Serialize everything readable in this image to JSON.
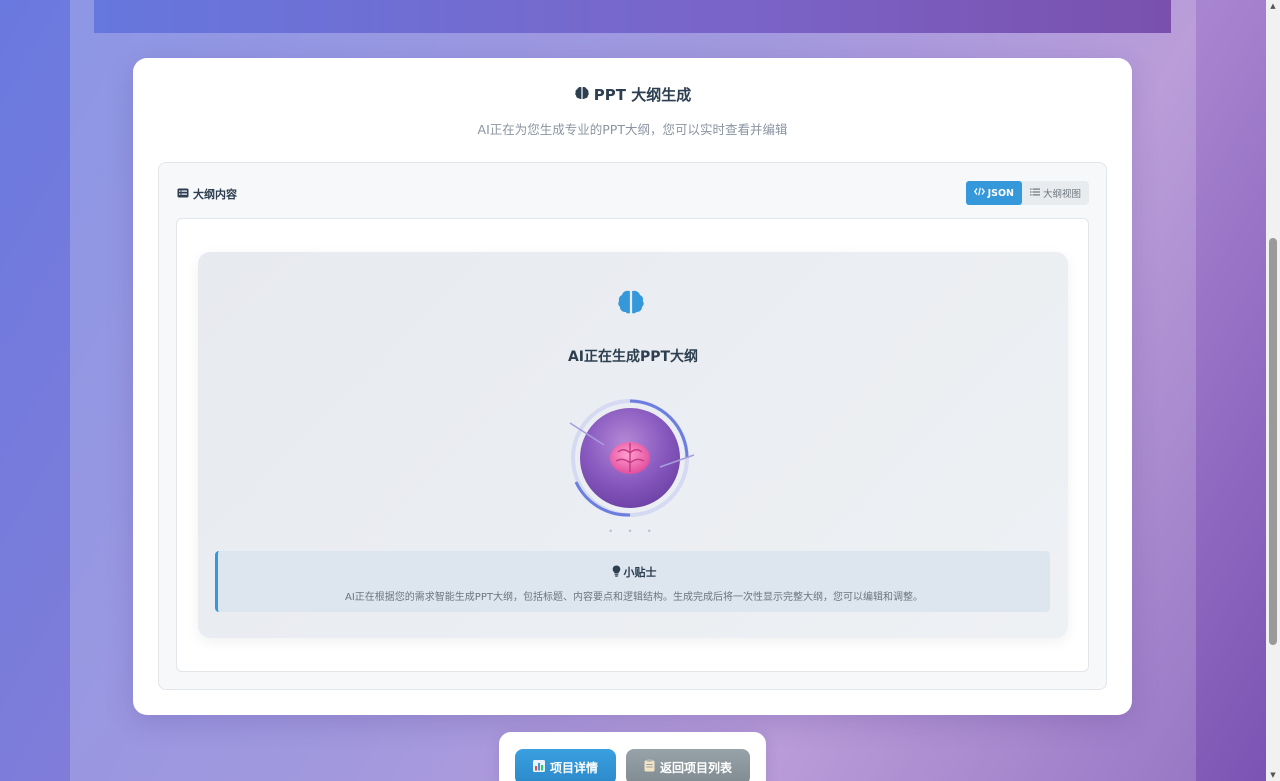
{
  "card": {
    "title": "PPT 大纲生成",
    "subtitle": "AI正在为您生成专业的PPT大纲，您可以实时查看并编辑"
  },
  "panel": {
    "header_label": "大纲内容",
    "toggle": {
      "json_label": "JSON",
      "outline_label": "大纲视图",
      "active": "JSON"
    }
  },
  "loading": {
    "title": "AI正在生成PPT大纲",
    "dots": "• • •"
  },
  "tip": {
    "title": "小贴士",
    "text": "AI正在根据您的需求智能生成PPT大纲，包括标题、内容要点和逻辑结构。生成完成后将一次性显示完整大纲，您可以编辑和调整。"
  },
  "actions": {
    "details_label": "项目详情",
    "back_label": "返回项目列表"
  },
  "colors": {
    "accent": "#3498db",
    "title_text": "#2c3e50",
    "back_button": "#8a969b"
  }
}
